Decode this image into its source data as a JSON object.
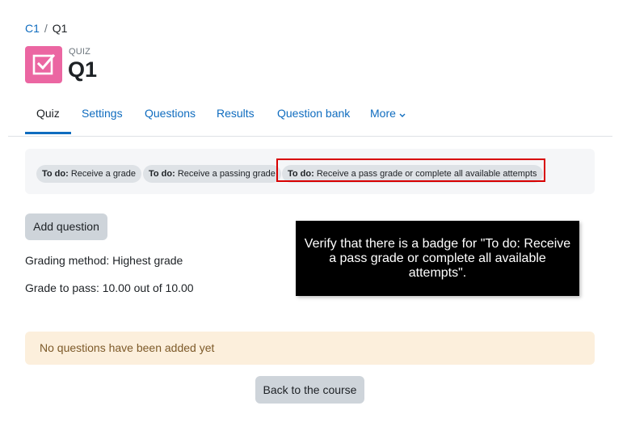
{
  "breadcrumb": {
    "course": "C1",
    "separator": "/",
    "current": "Q1"
  },
  "header": {
    "kind": "QUIZ",
    "title": "Q1",
    "icon": "quiz-checkbox-icon",
    "icon_color": "#eb66a2"
  },
  "tabs": [
    {
      "label": "Quiz",
      "active": true
    },
    {
      "label": "Settings"
    },
    {
      "label": "Questions"
    },
    {
      "label": "Results"
    },
    {
      "label": "Question bank"
    },
    {
      "label": "More"
    }
  ],
  "completion": {
    "badges": [
      {
        "prefix": "To do:",
        "text": "Receive a grade"
      },
      {
        "prefix": "To do:",
        "text": "Receive a passing grade"
      },
      {
        "prefix": "To do:",
        "text": "Receive a pass grade or complete all available attempts"
      }
    ]
  },
  "actions": {
    "add_question": "Add question",
    "back_to_course": "Back to the course"
  },
  "info": {
    "grading_method": "Grading method: Highest grade",
    "grade_to_pass": "Grade to pass: 10.00 out of 10.00"
  },
  "tooltip": {
    "text": "Verify that there is a badge for \"To do: Receive a pass grade or complete all available attempts\"."
  },
  "alert": {
    "text": "No questions have been added yet"
  },
  "colors": {
    "link": "#0f6cbf",
    "highlight": "#d80000",
    "alert_bg": "#fcefdc"
  }
}
